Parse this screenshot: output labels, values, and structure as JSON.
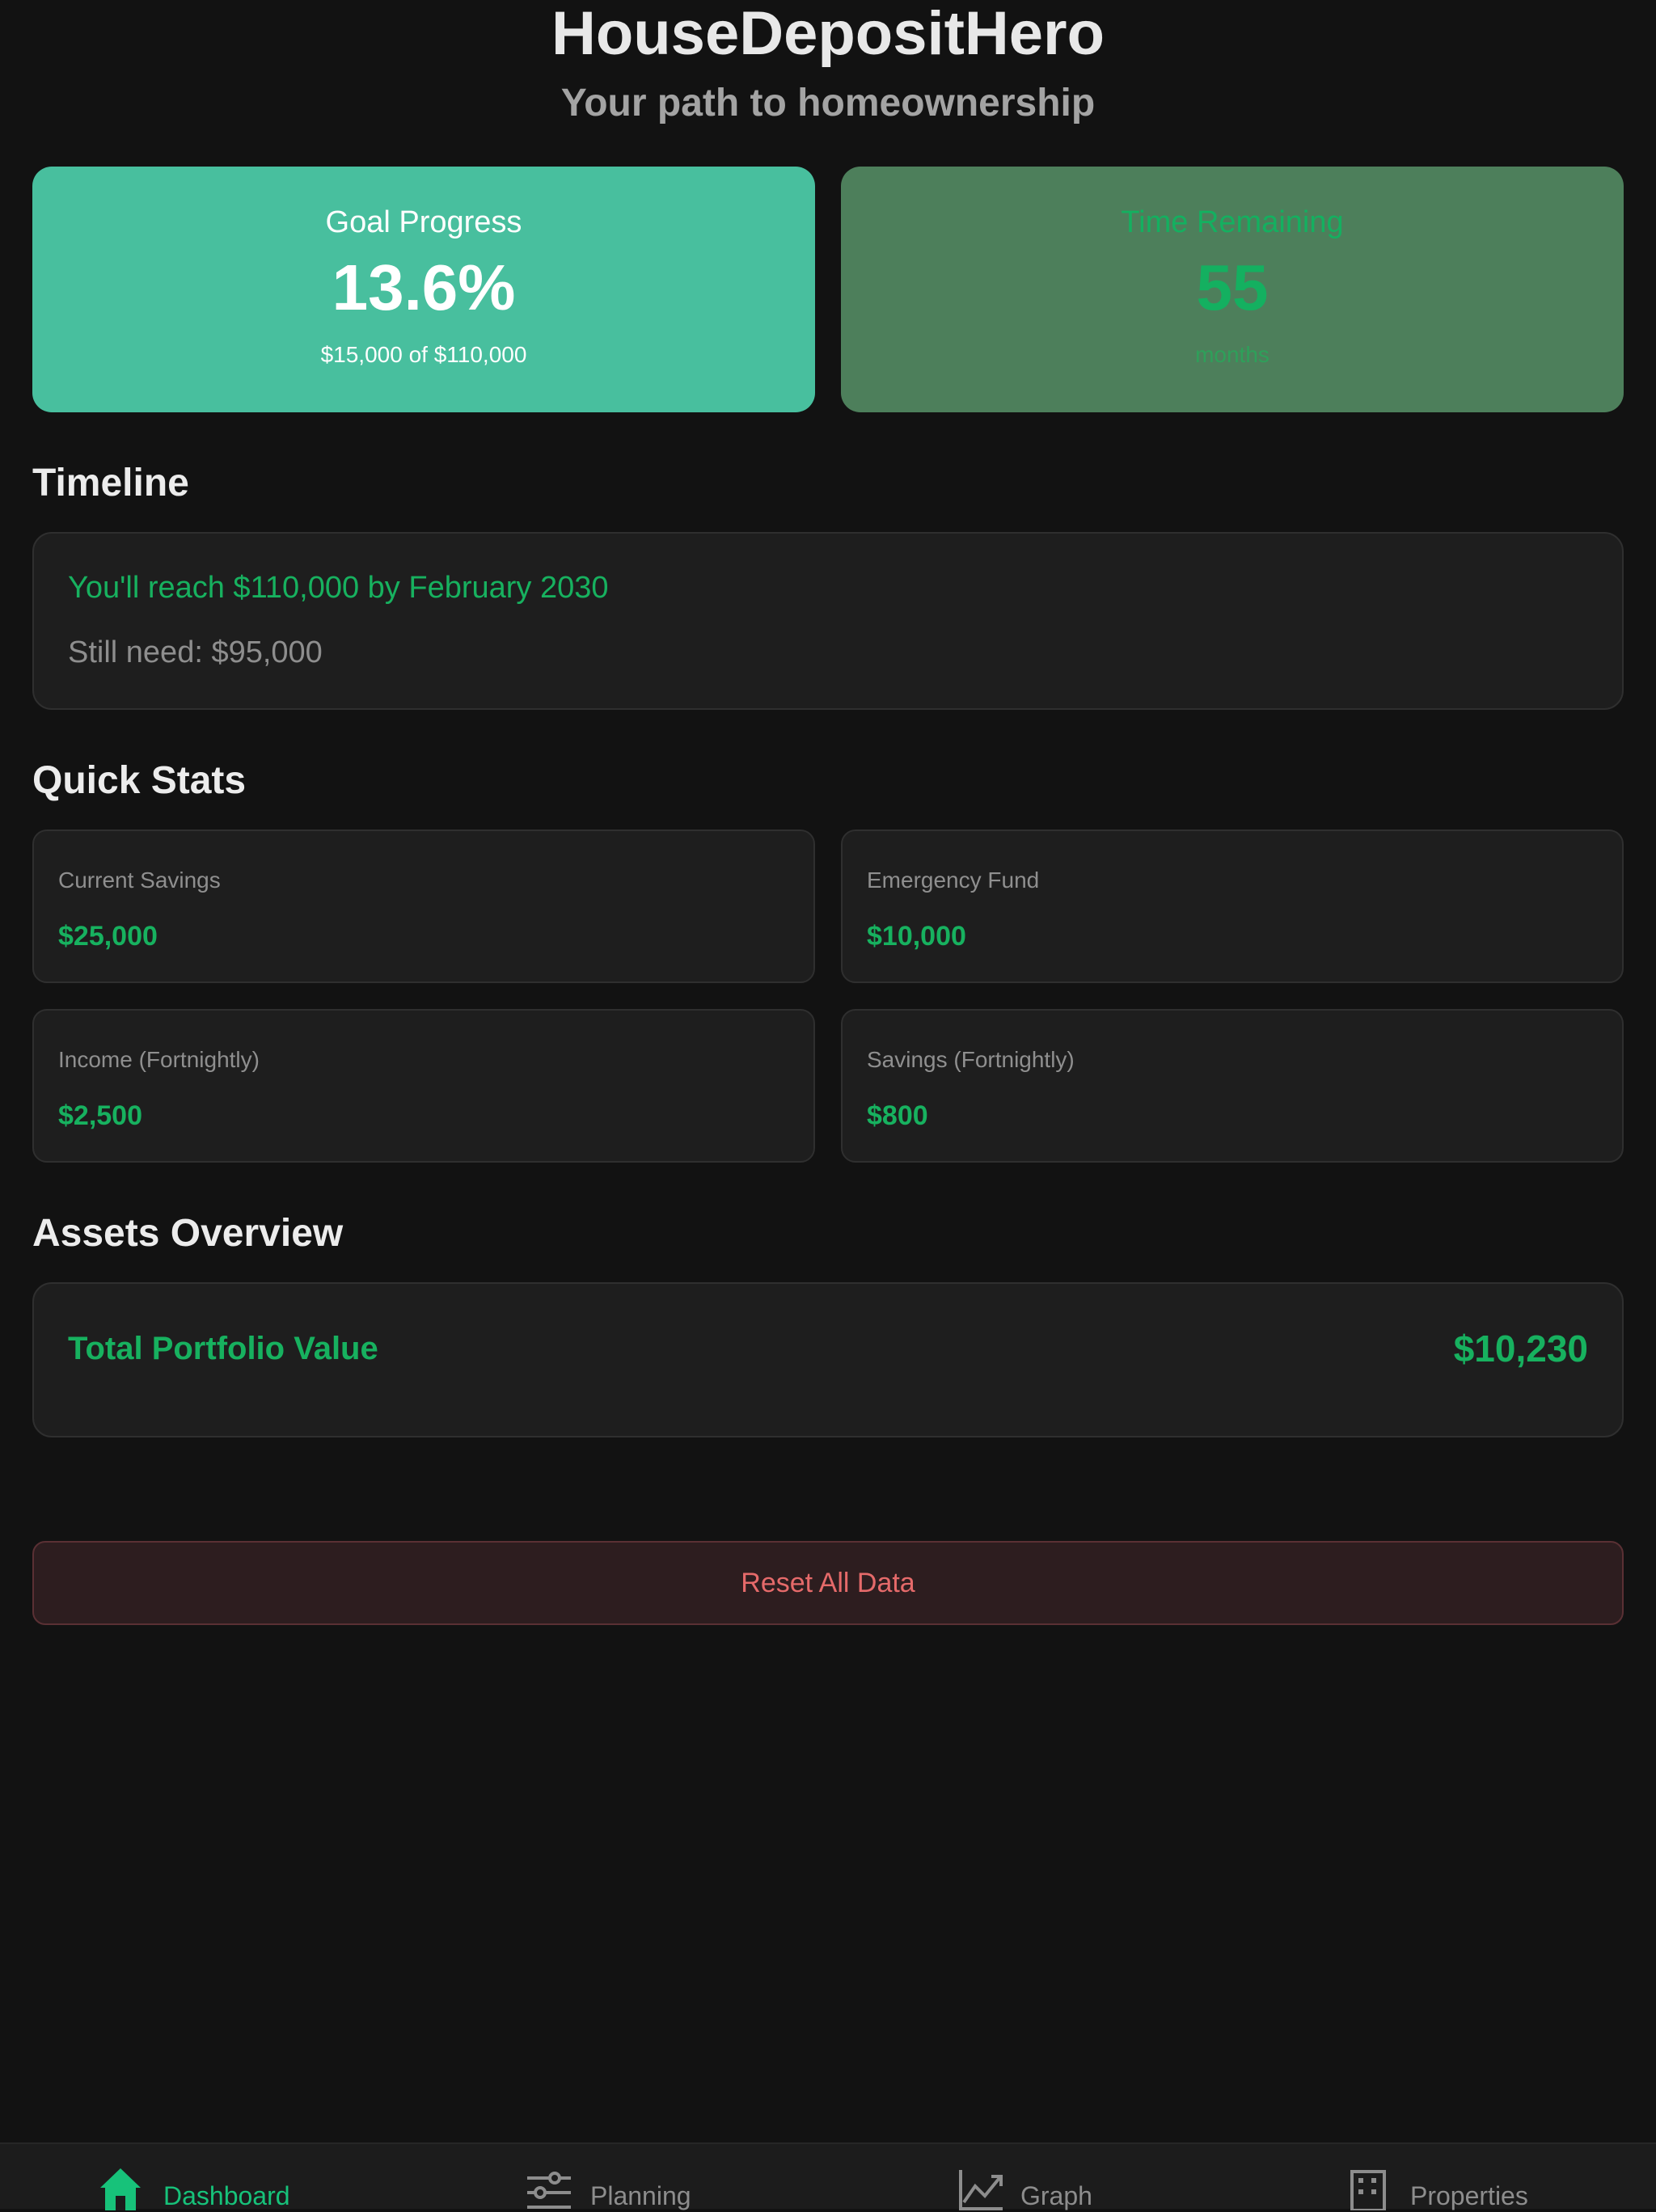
{
  "header": {
    "title": "HouseDepositHero",
    "subtitle": "Your path to homeownership"
  },
  "hero": {
    "progress": {
      "label": "Goal Progress",
      "value": "13.6%",
      "sub": "$15,000 of $110,000"
    },
    "time": {
      "label": "Time Remaining",
      "value": "55",
      "sub": "months"
    }
  },
  "timeline": {
    "section_title": "Timeline",
    "main": "You'll reach $110,000 by February 2030",
    "need": "Still need: $95,000"
  },
  "quick_stats": {
    "section_title": "Quick Stats",
    "items": [
      {
        "label": "Current Savings",
        "value": "$25,000"
      },
      {
        "label": "Emergency Fund",
        "value": "$10,000"
      },
      {
        "label": "Income (Fortnightly)",
        "value": "$2,500"
      },
      {
        "label": "Savings (Fortnightly)",
        "value": "$800"
      }
    ]
  },
  "assets": {
    "section_title": "Assets Overview",
    "label": "Total Portfolio Value",
    "value": "$10,230"
  },
  "actions": {
    "reset_label": "Reset All Data"
  },
  "tabs": [
    {
      "label": "Dashboard",
      "icon": "home-icon",
      "active": true
    },
    {
      "label": "Planning",
      "icon": "sliders-icon",
      "active": false
    },
    {
      "label": "Graph",
      "icon": "trend-chart-icon",
      "active": false
    },
    {
      "label": "Properties",
      "icon": "building-icon",
      "active": false
    }
  ],
  "colors": {
    "background": "#121212",
    "accent_green": "#17b15f",
    "progress_card": "#48bf9e",
    "time_card": "#4d7f5b",
    "danger": "#e56a6a"
  }
}
